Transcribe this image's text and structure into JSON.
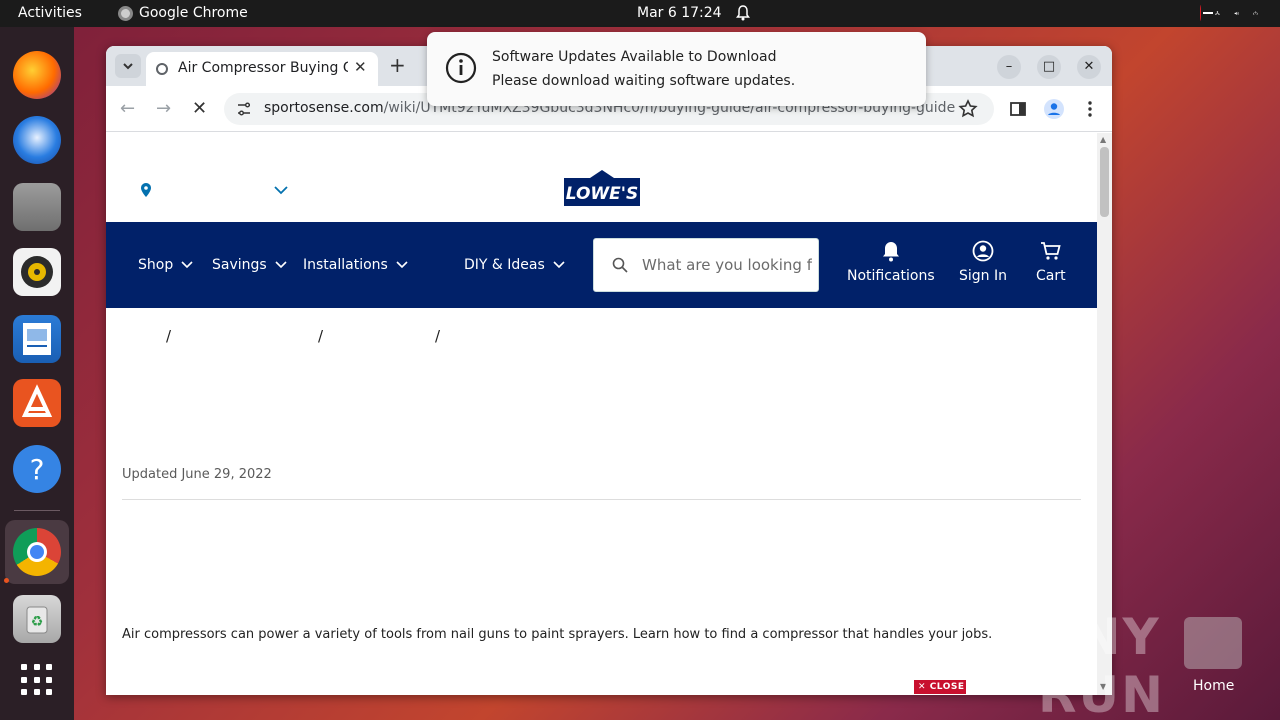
{
  "topbar": {
    "activities": "Activities",
    "app_name": "Google Chrome",
    "clock": "Mar 6  17:24"
  },
  "dock": {
    "apps": [
      "firefox-icon",
      "thunderbird-icon",
      "files-icon",
      "rhythmbox-icon",
      "libreoffice-writer-icon",
      "app-center-icon",
      "help-icon",
      "chrome-icon",
      "trash-icon",
      "show-apps-icon"
    ]
  },
  "browser": {
    "tab_title": "Air Compressor Buying Guide",
    "url_host": "sportosense.com",
    "url_path": "/wiki/UTMt92YuMXZ39Gbuc3d3NHc0/n/buying-guide/air-compressor-buying-guide"
  },
  "site": {
    "nav": {
      "shop": "Shop",
      "savings": "Savings",
      "installations": "Installations",
      "diy": "DIY & Ideas"
    },
    "search_placeholder": "What are you looking for today?",
    "notifications": "Notifications",
    "sign_in": "Sign In",
    "cart": "Cart",
    "crumb_sep": "/",
    "updated": "Updated June 29, 2022",
    "intro": "Air compressors can power a variety of tools from nail guns to paint sprayers. Learn how to find a compressor that handles your jobs."
  },
  "notification": {
    "title": "Software Updates Available to Download",
    "body": "Please download waiting software updates."
  },
  "ad": {
    "close_label": "CLOSE"
  },
  "desktop": {
    "home_label": "Home",
    "watermark": "ANY RUN"
  },
  "colors": {
    "lowes_blue": "#012169",
    "ubuntu_orange": "#e95420"
  }
}
